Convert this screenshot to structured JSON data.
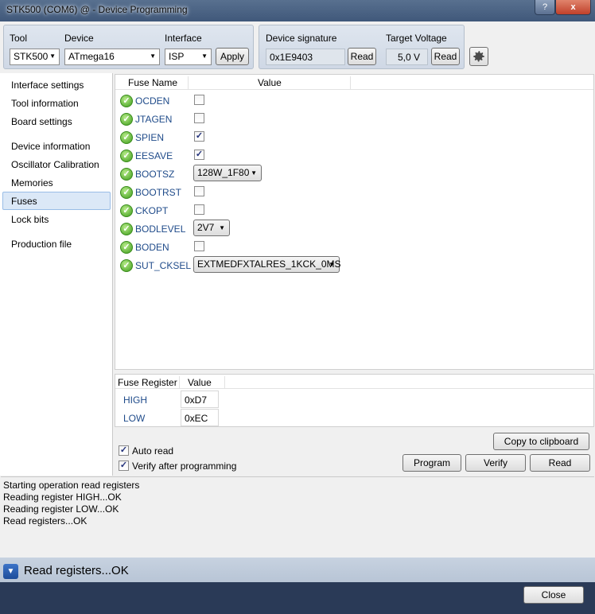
{
  "window": {
    "title": "STK500 (COM6) @  - Device Programming",
    "help_label": "?",
    "close_glyph": "x"
  },
  "toolbar": {
    "tool_label": "Tool",
    "tool_value": "STK500",
    "device_label": "Device",
    "device_value": "ATmega16",
    "interface_label": "Interface",
    "interface_value": "ISP",
    "apply_label": "Apply",
    "signature_label": "Device signature",
    "signature_value": "0x1E9403",
    "signature_read": "Read",
    "voltage_label": "Target Voltage",
    "voltage_value": "5,0 V",
    "voltage_read": "Read",
    "settings_icon": "gear-icon"
  },
  "sidebar": {
    "items": [
      {
        "label": "Interface settings"
      },
      {
        "label": "Tool information"
      },
      {
        "label": "Board settings"
      },
      {
        "label": "Device information"
      },
      {
        "label": "Oscillator Calibration"
      },
      {
        "label": "Memories"
      },
      {
        "label": "Fuses"
      },
      {
        "label": "Lock bits"
      },
      {
        "label": "Production file"
      }
    ],
    "selected": "Fuses"
  },
  "fuses": {
    "col_name": "Fuse Name",
    "col_value": "Value",
    "rows": [
      {
        "name": "OCDEN",
        "type": "checkbox",
        "checked": false
      },
      {
        "name": "JTAGEN",
        "type": "checkbox",
        "checked": false
      },
      {
        "name": "SPIEN",
        "type": "checkbox",
        "checked": true
      },
      {
        "name": "EESAVE",
        "type": "checkbox",
        "checked": true
      },
      {
        "name": "BOOTSZ",
        "type": "select",
        "value": "128W_1F80"
      },
      {
        "name": "BOOTRST",
        "type": "checkbox",
        "checked": false
      },
      {
        "name": "CKOPT",
        "type": "checkbox",
        "checked": false
      },
      {
        "name": "BODLEVEL",
        "type": "select",
        "value": "2V7"
      },
      {
        "name": "BODEN",
        "type": "checkbox",
        "checked": false
      },
      {
        "name": "SUT_CKSEL",
        "type": "select",
        "value": "EXTMEDFXTALRES_1KCK_0MS"
      }
    ]
  },
  "registers": {
    "col_register": "Fuse Register",
    "col_value": "Value",
    "rows": [
      {
        "name": "HIGH",
        "value": "0xD7"
      },
      {
        "name": "LOW",
        "value": "0xEC"
      }
    ]
  },
  "options": {
    "auto_read": "Auto read",
    "verify_after": "Verify after programming",
    "copy_clipboard": "Copy to clipboard",
    "program": "Program",
    "verify": "Verify",
    "read": "Read"
  },
  "log": {
    "lines": [
      "Starting operation read registers",
      "Reading register HIGH...OK",
      "Reading register LOW...OK",
      "Read registers...OK"
    ]
  },
  "status": {
    "message": "Read registers...OK"
  },
  "footer": {
    "close_label": "Close"
  }
}
